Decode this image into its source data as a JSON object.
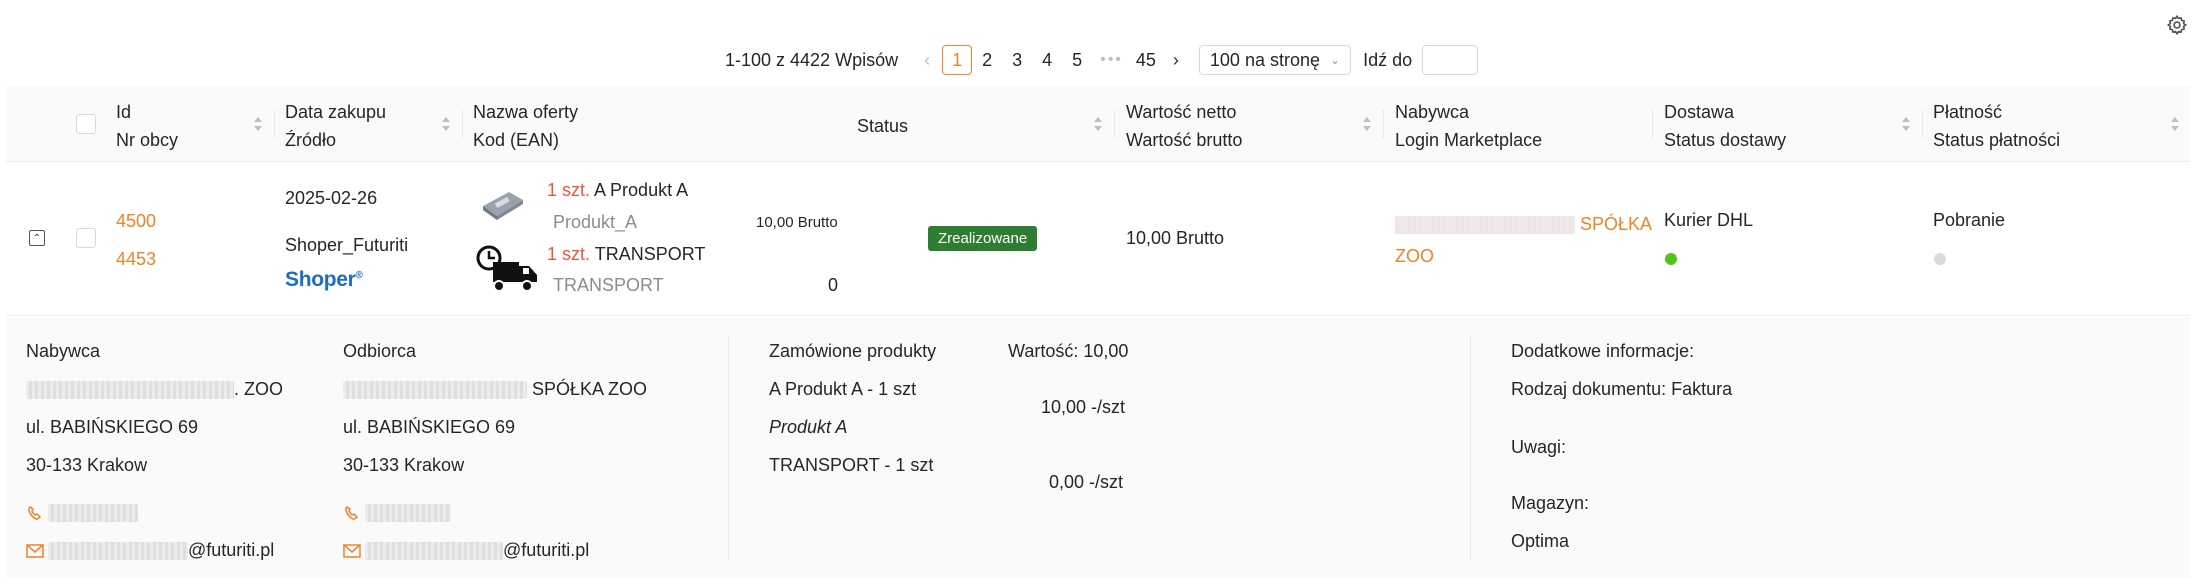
{
  "pagination": {
    "total_label": "1-100 z 4422 Wpisów",
    "pages": [
      "1",
      "2",
      "3",
      "4",
      "5"
    ],
    "current_page": "1",
    "ellipsis": "•••",
    "last_page": "45",
    "page_size": "100 na stronę",
    "goto_label": "Idź do",
    "goto_value": ""
  },
  "columns": {
    "id": [
      "Id",
      "Nr obcy"
    ],
    "date": [
      "Data zakupu",
      "Źródło"
    ],
    "offer": [
      "Nazwa oferty",
      "Kod (EAN)"
    ],
    "status": "Status",
    "value": [
      "Wartość netto",
      "Wartość brutto"
    ],
    "buyer": [
      "Nabywca",
      "Login Marketplace"
    ],
    "delivery": [
      "Dostawa",
      "Status dostawy"
    ],
    "payment": [
      "Płatność",
      "Status płatności"
    ]
  },
  "order": {
    "id": "4500",
    "external_no": "4453",
    "date": "2025-02-26",
    "source": "Shoper_Futuriti",
    "source_logo": "Shoper",
    "items": [
      {
        "qty": "1 szt.",
        "name": "A Produkt A",
        "code": "Produkt_A",
        "price": "10,00 Brutto"
      },
      {
        "qty": "1 szt.",
        "name": "TRANSPORT",
        "code": "TRANSPORT",
        "price": "0"
      }
    ],
    "status": "Zrealizowane",
    "value": "10,00 Brutto",
    "buyer_suffix": "SPÓŁKA",
    "buyer_suffix2": "ZOO",
    "delivery": "Kurier DHL",
    "delivery_status_color": "#52c41a",
    "payment": "Pobranie",
    "payment_status_color": "#d9d9d9"
  },
  "detail": {
    "buyer": {
      "title": "Nabywca",
      "name_suffix": ". ZOO",
      "street": "ul. BABIŃSKIEGO 69",
      "city": "30-133  Krakow",
      "email_suffix": "@futuriti.pl"
    },
    "recipient": {
      "title": "Odbiorca",
      "name_suffix": "SPÓŁKA ZOO",
      "street": "ul. BABIŃSKIEGO 69",
      "city": "30-133  Krakow",
      "email_suffix": "@futuriti.pl"
    },
    "products": {
      "title": "Zamówione produkty",
      "value_label": "Wartość: 10,00",
      "line1": "A Produkt A - 1 szt",
      "line1_price": "10,00 -/szt",
      "line1_sub": "Produkt A",
      "line2": "TRANSPORT - 1 szt",
      "line2_price": "0,00 -/szt"
    },
    "extra": {
      "title": "Dodatkowe informacje:",
      "doc_type": "Rodzaj dokumentu: Faktura",
      "notes": "Uwagi:",
      "warehouse": "Magazyn:",
      "warehouse_value": "Optima"
    }
  },
  "colors": {
    "accent": "#f08228",
    "status_green": "#2e7d32",
    "brand_blue": "#1a6fc0"
  }
}
